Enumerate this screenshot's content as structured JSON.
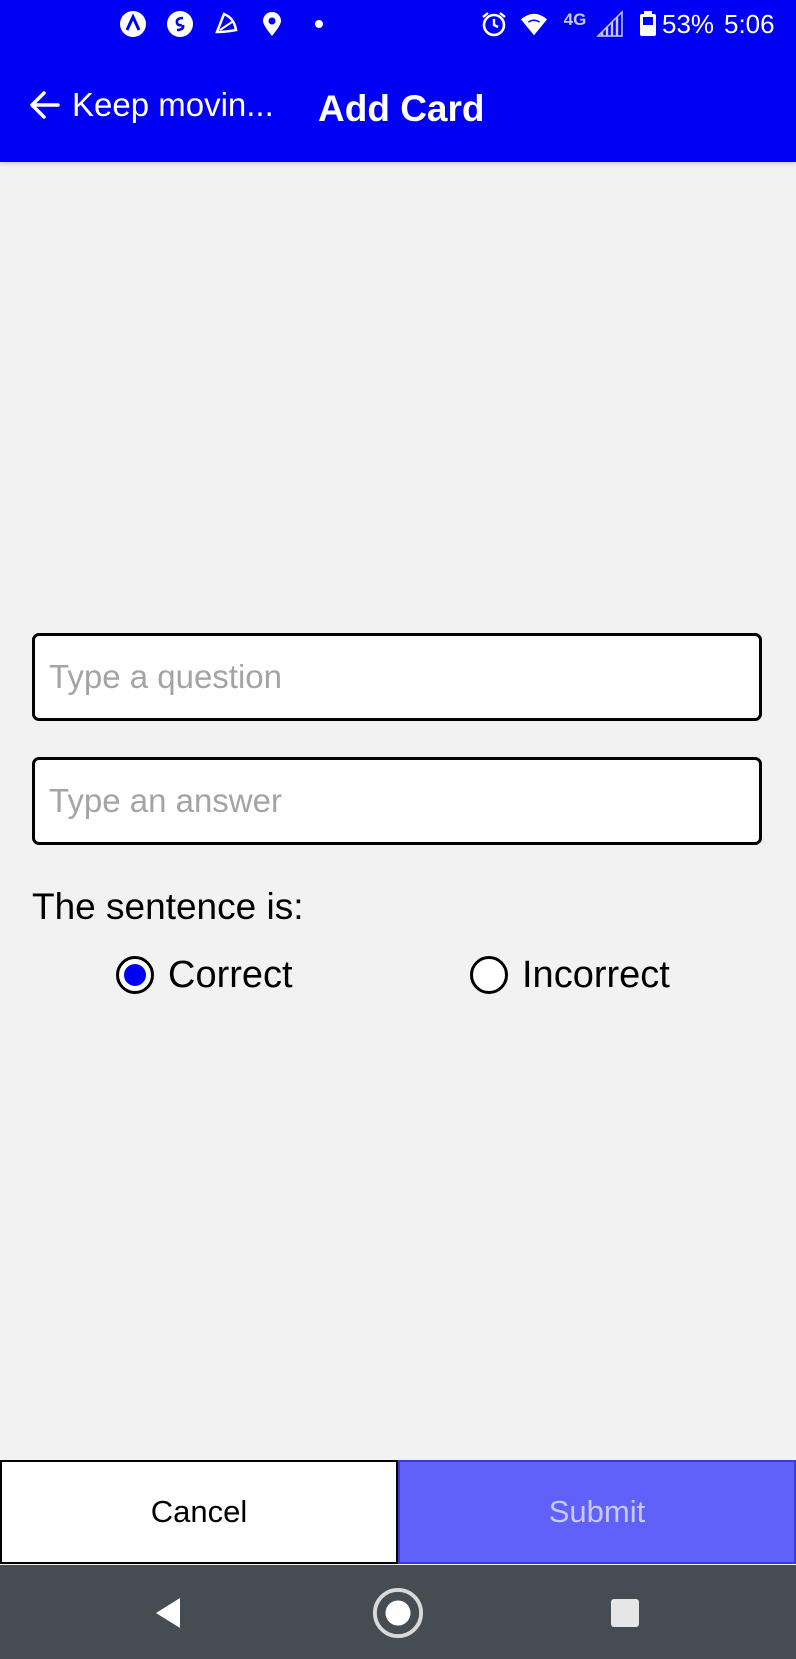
{
  "status_bar": {
    "battery": "53%",
    "time": "5:06",
    "network": "4G",
    "left_icons": [
      "app-a-icon",
      "shazam-icon",
      "leaf-icon",
      "location-icon",
      "dot-icon"
    ],
    "right_icons": [
      "alarm-icon",
      "wifi-icon",
      "signal-icon",
      "battery-icon"
    ]
  },
  "app_bar": {
    "back_label": "Keep movin...",
    "title": "Add Card"
  },
  "form": {
    "question_placeholder": "Type a question",
    "question_value": "",
    "answer_placeholder": "Type an answer",
    "answer_value": "",
    "prompt": "The sentence is:",
    "options": [
      {
        "label": "Correct",
        "selected": true
      },
      {
        "label": "Incorrect",
        "selected": false
      }
    ]
  },
  "actions": {
    "cancel_label": "Cancel",
    "submit_label": "Submit"
  },
  "colors": {
    "primary": "#0000f5",
    "submit_bg": "#6060fb",
    "background": "#f2f2f2",
    "nav_bar": "#454d52"
  }
}
